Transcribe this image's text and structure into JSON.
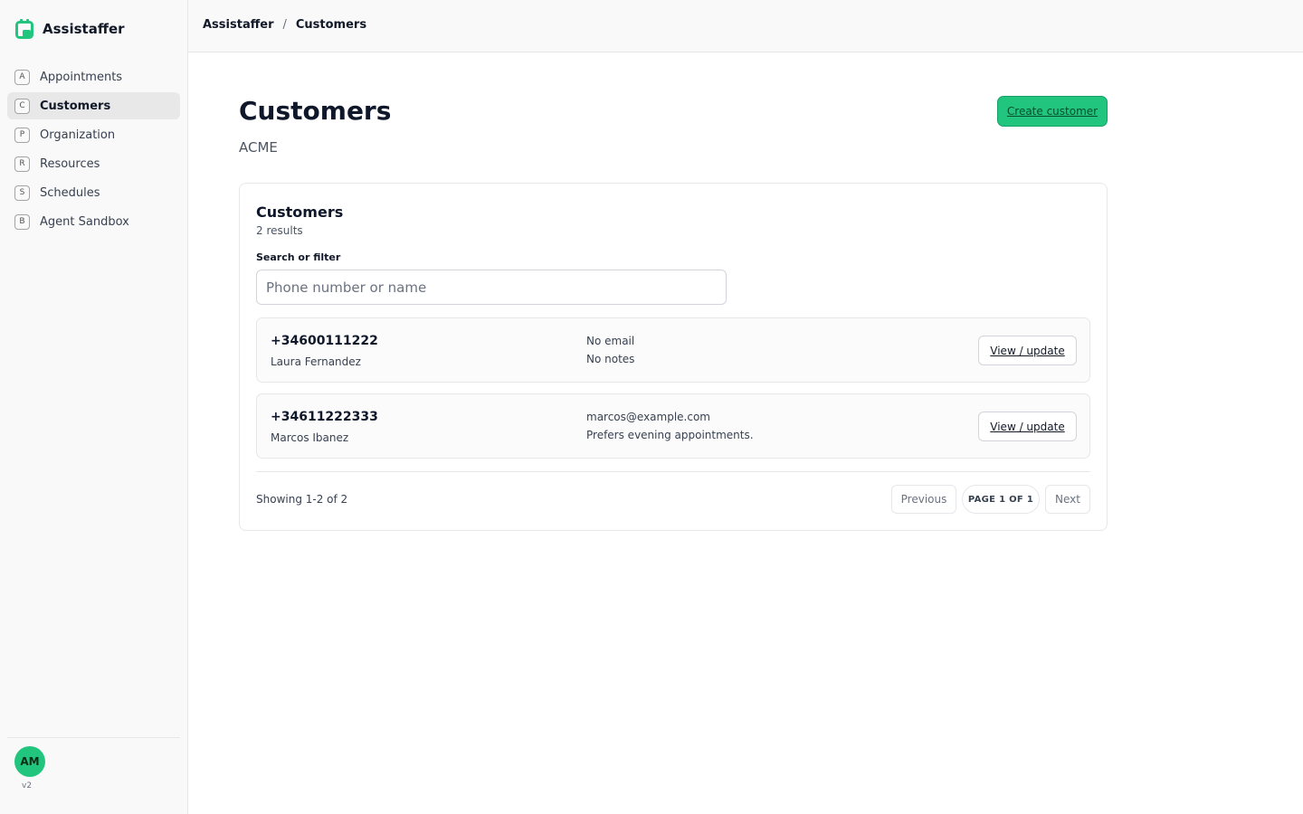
{
  "app": {
    "name": "Assistaffer",
    "version": "v2"
  },
  "colors": {
    "accent": "#22c57e",
    "avatar_bg": "#22c57e"
  },
  "sidebar": {
    "items": [
      {
        "key": "A",
        "label": "Appointments",
        "active": false
      },
      {
        "key": "C",
        "label": "Customers",
        "active": true
      },
      {
        "key": "P",
        "label": "Organization",
        "active": false
      },
      {
        "key": "R",
        "label": "Resources",
        "active": false
      },
      {
        "key": "S",
        "label": "Schedules",
        "active": false
      },
      {
        "key": "B",
        "label": "Agent Sandbox",
        "active": false
      }
    ],
    "user_initials": "AM"
  },
  "breadcrumb": {
    "root": "Assistaffer",
    "separator": "/",
    "current": "Customers"
  },
  "page": {
    "title": "Customers",
    "subtitle": "ACME",
    "create_label": "Create customer"
  },
  "card": {
    "title": "Customers",
    "count": "2 results",
    "search_label": "Search or filter",
    "search_placeholder": "Phone number or name",
    "search_value": "",
    "rows": [
      {
        "phone": "+34600111222",
        "name": "Laura Fernandez",
        "email": "No email",
        "notes": "No notes",
        "action": "View / update"
      },
      {
        "phone": "+34611222333",
        "name": "Marcos Ibanez",
        "email": "marcos@example.com",
        "notes": "Prefers evening appointments.",
        "action": "View / update"
      }
    ],
    "showing": "Showing 1-2 of 2",
    "pagination": {
      "previous": "Previous",
      "page": "PAGE 1 OF 1",
      "next": "Next"
    }
  }
}
